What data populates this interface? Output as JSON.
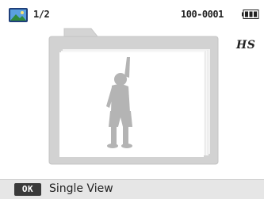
{
  "status": {
    "album_icon": "album-icon",
    "page_counter": "1/2",
    "file_number": "100-0001",
    "battery_icon": "battery-full-icon"
  },
  "side": {
    "mode_badge": "HS"
  },
  "viewer": {
    "folder_icon": "folder-icon",
    "placeholder_icon": "person-silhouette-icon"
  },
  "bottom_bar": {
    "key_label": "OK",
    "action_label": "Single View"
  },
  "colors": {
    "folder_frame": "#d2d2d2",
    "folder_inner": "#ffffff",
    "silhouette": "#b4b4b4",
    "bottom_bar": "#e6e6e6",
    "key_bg": "#3a3a3a"
  }
}
